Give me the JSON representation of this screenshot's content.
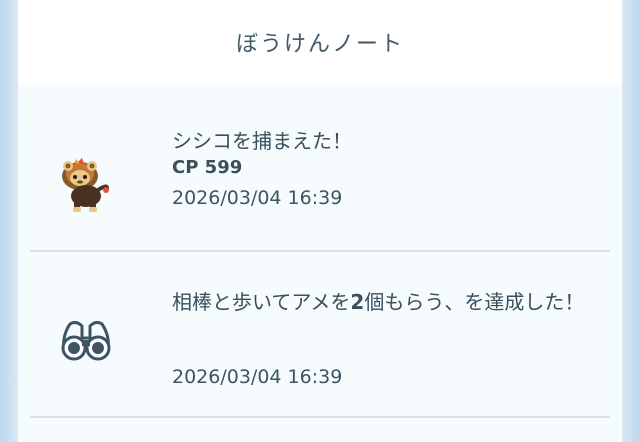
{
  "header": {
    "title": "ぼうけんノート"
  },
  "entries": [
    {
      "icon": "litleo-pokemon-icon",
      "title": "シシコを捕まえた！",
      "cp": "CP 599",
      "timestamp": "2026/03/04 16:39"
    },
    {
      "icon": "binoculars-icon",
      "title_prefix": "相棒と歩いてアメを",
      "title_number": "2",
      "title_suffix": "個もらう、を達成した！",
      "timestamp": "2026/03/04 16:39"
    }
  ],
  "colors": {
    "text": "#3a4f5c",
    "panel_bg": "#f6fbfd",
    "divider": "#d7e1e6",
    "side_bg": "#cfe3f2"
  }
}
